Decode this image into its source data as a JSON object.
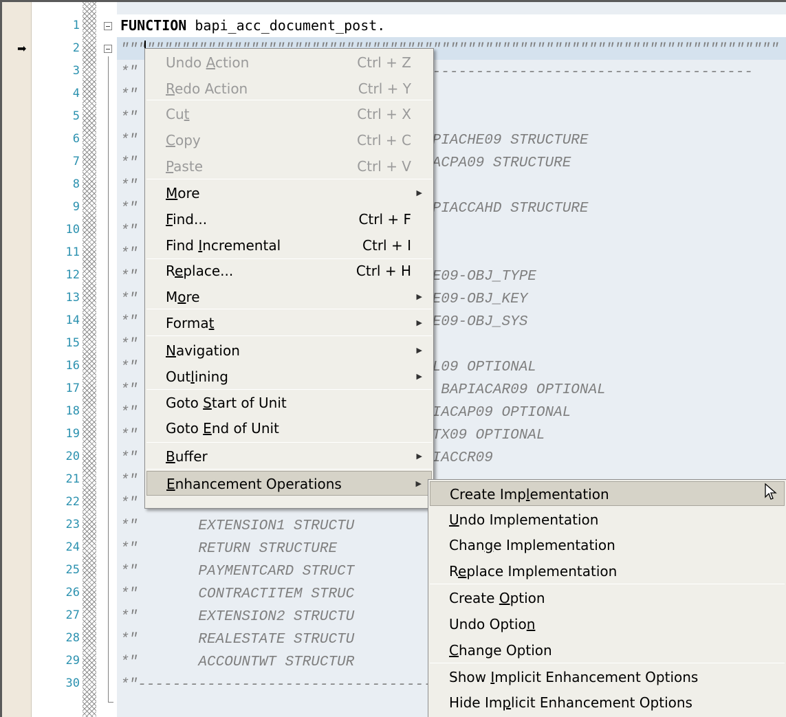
{
  "editor": {
    "line_numbers": [
      "1",
      "2",
      "3",
      "4",
      "5",
      "6",
      "7",
      "8",
      "9",
      "10",
      "11",
      "12",
      "13",
      "14",
      "15",
      "16",
      "17",
      "18",
      "19",
      "20",
      "21",
      "22",
      "23",
      "24",
      "25",
      "26",
      "27",
      "28",
      "29",
      "30"
    ],
    "execution_marker": "➡",
    "code_lines": [
      {
        "kw": "FUNCTION",
        "text": " bapi_acc_document_post."
      },
      {
        "cmt": "\"\"\"\"\"\"\"\"\"\"\"\"\"\"\"\"\"\"\"\"\"\"\"\"\"\"\"\"\"\"\"\"\"\"\"\"\"\"\"\"\"\"\"\"\"\"\"\"\"\"\"\"\"\"\"\"\"\"\"\"\"\"\"\"\"\"\"\"\"\"\"\"\"\"\"\""
      },
      {
        "cmt": "*\"                          ---------------------------------------------"
      },
      {
        "cmt": "*\""
      },
      {
        "cmt": "*\""
      },
      {
        "cmt": "*\"                        ) LIKE  BAPIACHE09 STRUCTURE"
      },
      {
        "cmt": "*\"                        LIKE  BAPIACPA09 STRUCTURE"
      },
      {
        "cmt": "*\""
      },
      {
        "cmt": "*\"                        ) LIKE  BAPIACCAHD STRUCTURE"
      },
      {
        "cmt": "*\""
      },
      {
        "cmt": "*\""
      },
      {
        "cmt": "*\"                        E  BAPIACHE09-OBJ_TYPE"
      },
      {
        "cmt": "*\"                           BAPIACHE09-OBJ_KEY"
      },
      {
        "cmt": "*\"                           BAPIACHE09-OBJ_SYS"
      },
      {
        "cmt": "*\""
      },
      {
        "cmt": "*\"                        E  BAPIACGL09 OPTIONAL"
      },
      {
        "cmt": "*\"                        STRUCTURE  BAPIACAR09 OPTIONAL"
      },
      {
        "cmt": "*\"                        CTURE  BAPIACAP09 OPTIONAL"
      },
      {
        "cmt": "*\"                        RE  BAPIACTX09 OPTIONAL"
      },
      {
        "cmt": "*\"                        CTURE  BAPIACCR09"
      },
      {
        "cmt": "*\""
      },
      {
        "cmt": "*\"       VALUEFIELD STRUCTU"
      },
      {
        "cmt": "*\"       EXTENSION1 STRUCTU"
      },
      {
        "cmt": "*\"       RETURN STRUCTURE"
      },
      {
        "cmt": "*\"       PAYMENTCARD STRUCT"
      },
      {
        "cmt": "*\"       CONTRACTITEM STRUC"
      },
      {
        "cmt": "*\"       EXTENSION2 STRUCTU"
      },
      {
        "cmt": "*\"       REALESTATE STRUCTU"
      },
      {
        "cmt": "*\"       ACCOUNTWT STRUCTUR"
      },
      {
        "cmt": "*\"----------------------------------------------"
      }
    ]
  },
  "context_menu": {
    "items": [
      {
        "pre": "Undo ",
        "u": "A",
        "post": "ction",
        "shortcut": "Ctrl + Z",
        "disabled": true
      },
      {
        "pre": "",
        "u": "R",
        "post": "edo Action",
        "shortcut": "Ctrl + Y",
        "disabled": true
      },
      {
        "pre": "Cu",
        "u": "t",
        "post": "",
        "shortcut": "Ctrl + X",
        "disabled": true
      },
      {
        "pre": "",
        "u": "C",
        "post": "opy",
        "shortcut": "Ctrl + C",
        "disabled": true
      },
      {
        "pre": "",
        "u": "P",
        "post": "aste",
        "shortcut": "Ctrl + V",
        "disabled": true
      },
      {
        "pre": "",
        "u": "M",
        "post": "ore",
        "shortcut": "",
        "submenu": true
      },
      {
        "pre": "",
        "u": "F",
        "post": "ind...",
        "shortcut": "Ctrl + F"
      },
      {
        "pre": "Find ",
        "u": "I",
        "post": "ncremental",
        "shortcut": "Ctrl + I"
      },
      {
        "pre": "R",
        "u": "e",
        "post": "place...",
        "shortcut": "Ctrl + H"
      },
      {
        "pre": "M",
        "u": "o",
        "post": "re",
        "shortcut": "",
        "submenu": true
      },
      {
        "pre": "Forma",
        "u": "t",
        "post": "",
        "shortcut": "",
        "submenu": true
      },
      {
        "pre": "",
        "u": "N",
        "post": "avigation",
        "shortcut": "",
        "submenu": true
      },
      {
        "pre": "Out",
        "u": "l",
        "post": "ining",
        "shortcut": "",
        "submenu": true
      },
      {
        "pre": "Goto ",
        "u": "S",
        "post": "tart of Unit",
        "shortcut": ""
      },
      {
        "pre": "Goto ",
        "u": "E",
        "post": "nd of Unit",
        "shortcut": ""
      },
      {
        "pre": "",
        "u": "B",
        "post": "uffer",
        "shortcut": "",
        "submenu": true
      },
      {
        "pre": "",
        "u": "E",
        "post": "nhancement Operations",
        "shortcut": "",
        "submenu": true,
        "highlighted": true
      }
    ]
  },
  "submenu": {
    "items": [
      {
        "pre": "Create Imp",
        "u": "l",
        "post": "ementation",
        "highlighted": true
      },
      {
        "pre": "",
        "u": "U",
        "post": "ndo Implementation"
      },
      {
        "pre": "Chan",
        "u": "g",
        "post": "e Implementation"
      },
      {
        "pre": "R",
        "u": "e",
        "post": "place Implementation"
      },
      {
        "pre": "Create ",
        "u": "O",
        "post": "ption"
      },
      {
        "pre": "Undo Optio",
        "u": "n",
        "post": ""
      },
      {
        "pre": "",
        "u": "C",
        "post": "hange Option"
      },
      {
        "pre": "Show ",
        "u": "I",
        "post": "mplicit Enhancement Options"
      },
      {
        "pre": "Hide Im",
        "u": "p",
        "post": "licit Enhancement Options"
      }
    ]
  },
  "icons": {
    "submenu_arrow": "triangle-right-icon",
    "pointer": "mouse-pointer-icon",
    "exec": "arrow-right-icon"
  }
}
